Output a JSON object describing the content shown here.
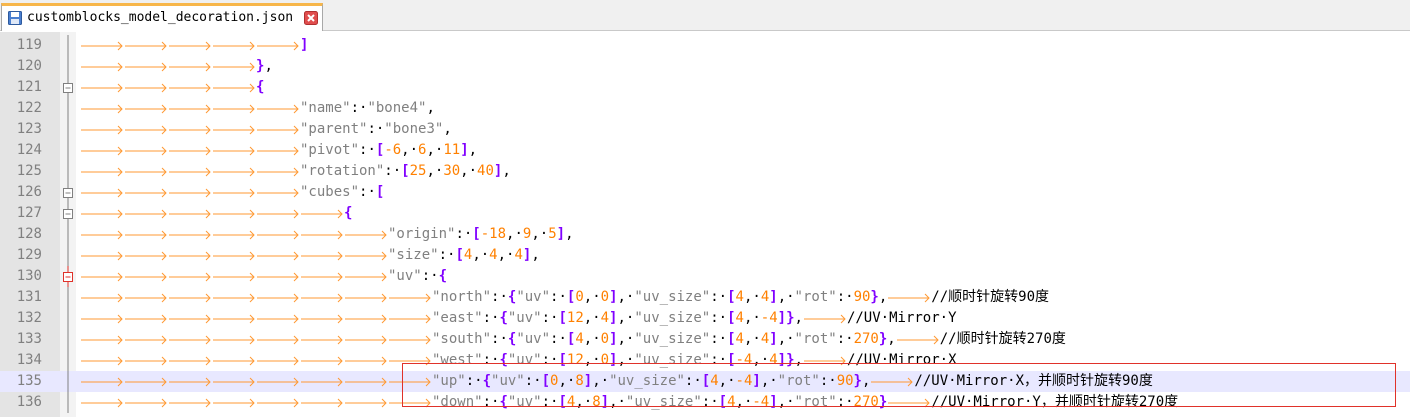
{
  "tab": {
    "label": "customblocks_model_decoration.json",
    "icon": "save-disk-icon",
    "close_icon": "close-icon"
  },
  "colors": {
    "line_number": "#808080",
    "bracket": "#8000ff",
    "string": "#808080",
    "number": "#ff8000",
    "tab_arrow": "#ff9933",
    "fold_marker": "#808080",
    "fold_open_marker": "#e0322a",
    "annotation_box": "#e0322a",
    "current_line": "#e8e8ff"
  },
  "lines": [
    {
      "num": "119",
      "indent": 5,
      "fold": "line",
      "parts": [
        [
          "p",
          "]"
        ]
      ]
    },
    {
      "num": "120",
      "indent": 4,
      "fold": "line",
      "parts": [
        [
          "p",
          "}"
        ],
        [
          "c",
          ","
        ]
      ]
    },
    {
      "num": "121",
      "indent": 4,
      "fold": "box",
      "parts": [
        [
          "p",
          "{"
        ]
      ]
    },
    {
      "num": "122",
      "indent": 5,
      "fold": "line",
      "parts": [
        [
          "s",
          "\"name\""
        ],
        [
          "c",
          ":·"
        ],
        [
          "s",
          "\"bone4\""
        ],
        [
          "c",
          ","
        ]
      ]
    },
    {
      "num": "123",
      "indent": 5,
      "fold": "line",
      "parts": [
        [
          "s",
          "\"parent\""
        ],
        [
          "c",
          ":·"
        ],
        [
          "s",
          "\"bone3\""
        ],
        [
          "c",
          ","
        ]
      ]
    },
    {
      "num": "124",
      "indent": 5,
      "fold": "line",
      "parts": [
        [
          "s",
          "\"pivot\""
        ],
        [
          "c",
          ":·"
        ],
        [
          "p",
          "["
        ],
        [
          "n",
          "-6"
        ],
        [
          "c",
          ",·"
        ],
        [
          "n",
          "6"
        ],
        [
          "c",
          ",·"
        ],
        [
          "n",
          "11"
        ],
        [
          "p",
          "]"
        ],
        [
          "c",
          ","
        ]
      ]
    },
    {
      "num": "125",
      "indent": 5,
      "fold": "line",
      "parts": [
        [
          "s",
          "\"rotation\""
        ],
        [
          "c",
          ":·"
        ],
        [
          "p",
          "["
        ],
        [
          "n",
          "25"
        ],
        [
          "c",
          ",·"
        ],
        [
          "n",
          "30"
        ],
        [
          "c",
          ",·"
        ],
        [
          "n",
          "40"
        ],
        [
          "p",
          "]"
        ],
        [
          "c",
          ","
        ]
      ]
    },
    {
      "num": "126",
      "indent": 5,
      "fold": "box",
      "parts": [
        [
          "s",
          "\"cubes\""
        ],
        [
          "c",
          ":·"
        ],
        [
          "p",
          "["
        ]
      ]
    },
    {
      "num": "127",
      "indent": 6,
      "fold": "box",
      "parts": [
        [
          "p",
          "{"
        ]
      ]
    },
    {
      "num": "128",
      "indent": 7,
      "fold": "line",
      "parts": [
        [
          "s",
          "\"origin\""
        ],
        [
          "c",
          ":·"
        ],
        [
          "p",
          "["
        ],
        [
          "n",
          "-18"
        ],
        [
          "c",
          ",·"
        ],
        [
          "n",
          "9"
        ],
        [
          "c",
          ",·"
        ],
        [
          "n",
          "5"
        ],
        [
          "p",
          "]"
        ],
        [
          "c",
          ","
        ]
      ]
    },
    {
      "num": "129",
      "indent": 7,
      "fold": "line",
      "parts": [
        [
          "s",
          "\"size\""
        ],
        [
          "c",
          ":·"
        ],
        [
          "p",
          "["
        ],
        [
          "n",
          "4"
        ],
        [
          "c",
          ",·"
        ],
        [
          "n",
          "4"
        ],
        [
          "c",
          ",·"
        ],
        [
          "n",
          "4"
        ],
        [
          "p",
          "]"
        ],
        [
          "c",
          ","
        ]
      ]
    },
    {
      "num": "130",
      "indent": 7,
      "fold": "boxred",
      "parts": [
        [
          "s",
          "\"uv\""
        ],
        [
          "c",
          ":·"
        ],
        [
          "p",
          "{"
        ]
      ]
    },
    {
      "num": "131",
      "indent": 8,
      "fold": "line",
      "parts": [
        [
          "s",
          "\"north\""
        ],
        [
          "c",
          ":·"
        ],
        [
          "p",
          "{"
        ],
        [
          "s",
          "\"uv\""
        ],
        [
          "c",
          ":·"
        ],
        [
          "p",
          "["
        ],
        [
          "n",
          "0"
        ],
        [
          "c",
          ",·"
        ],
        [
          "n",
          "0"
        ],
        [
          "p",
          "]"
        ],
        [
          "c",
          ",·"
        ],
        [
          "s",
          "\"uv_size\""
        ],
        [
          "c",
          ":·"
        ],
        [
          "p",
          "["
        ],
        [
          "n",
          "4"
        ],
        [
          "c",
          ",·"
        ],
        [
          "n",
          "4"
        ],
        [
          "p",
          "]"
        ],
        [
          "c",
          ",·"
        ],
        [
          "s",
          "\"rot\""
        ],
        [
          "c",
          ":·"
        ],
        [
          "n",
          "90"
        ],
        [
          "p",
          "}"
        ],
        [
          "c",
          ","
        ],
        [
          "t",
          "→"
        ],
        [
          "c",
          "//顺时针旋转90度"
        ]
      ]
    },
    {
      "num": "132",
      "indent": 8,
      "fold": "line",
      "parts": [
        [
          "s",
          "\"east\""
        ],
        [
          "c",
          ":·"
        ],
        [
          "p",
          "{"
        ],
        [
          "s",
          "\"uv\""
        ],
        [
          "c",
          ":·"
        ],
        [
          "p",
          "["
        ],
        [
          "n",
          "12"
        ],
        [
          "c",
          ",·"
        ],
        [
          "n",
          "4"
        ],
        [
          "p",
          "]"
        ],
        [
          "c",
          ",·"
        ],
        [
          "s",
          "\"uv_size\""
        ],
        [
          "c",
          ":·"
        ],
        [
          "p",
          "["
        ],
        [
          "n",
          "4"
        ],
        [
          "c",
          ",·"
        ],
        [
          "n",
          "-4"
        ],
        [
          "p",
          "]}"
        ],
        [
          "c",
          ","
        ],
        [
          "t",
          "→"
        ],
        [
          "c",
          "//UV·Mirror·Y"
        ]
      ]
    },
    {
      "num": "133",
      "indent": 8,
      "fold": "line",
      "parts": [
        [
          "s",
          "\"south\""
        ],
        [
          "c",
          ":·"
        ],
        [
          "p",
          "{"
        ],
        [
          "s",
          "\"uv\""
        ],
        [
          "c",
          ":·"
        ],
        [
          "p",
          "["
        ],
        [
          "n",
          "4"
        ],
        [
          "c",
          ",·"
        ],
        [
          "n",
          "0"
        ],
        [
          "p",
          "]"
        ],
        [
          "c",
          ",·"
        ],
        [
          "s",
          "\"uv_size\""
        ],
        [
          "c",
          ":·"
        ],
        [
          "p",
          "["
        ],
        [
          "n",
          "4"
        ],
        [
          "c",
          ",·"
        ],
        [
          "n",
          "4"
        ],
        [
          "p",
          "]"
        ],
        [
          "c",
          ",·"
        ],
        [
          "s",
          "\"rot\""
        ],
        [
          "c",
          ":·"
        ],
        [
          "n",
          "270"
        ],
        [
          "p",
          "}"
        ],
        [
          "c",
          ","
        ],
        [
          "t",
          "→"
        ],
        [
          "c",
          "//顺时针旋转270度"
        ]
      ]
    },
    {
      "num": "134",
      "indent": 8,
      "fold": "line",
      "parts": [
        [
          "s",
          "\"west\""
        ],
        [
          "c",
          ":·"
        ],
        [
          "p",
          "{"
        ],
        [
          "s",
          "\"uv\""
        ],
        [
          "c",
          ":·"
        ],
        [
          "p",
          "["
        ],
        [
          "n",
          "12"
        ],
        [
          "c",
          ",·"
        ],
        [
          "n",
          "0"
        ],
        [
          "p",
          "]"
        ],
        [
          "c",
          ",·"
        ],
        [
          "s",
          "\"uv_size\""
        ],
        [
          "c",
          ":·"
        ],
        [
          "p",
          "["
        ],
        [
          "n",
          "-4"
        ],
        [
          "c",
          ",·"
        ],
        [
          "n",
          "4"
        ],
        [
          "p",
          "]}"
        ],
        [
          "c",
          ","
        ],
        [
          "t",
          "→"
        ],
        [
          "c",
          "//UV·Mirror·X"
        ]
      ]
    },
    {
      "num": "135",
      "indent": 8,
      "fold": "line",
      "current": true,
      "parts": [
        [
          "s",
          "\"up\""
        ],
        [
          "c",
          ":·"
        ],
        [
          "p",
          "{"
        ],
        [
          "s",
          "\"uv\""
        ],
        [
          "c",
          ":·"
        ],
        [
          "p",
          "["
        ],
        [
          "n",
          "0"
        ],
        [
          "c",
          ",·"
        ],
        [
          "n",
          "8"
        ],
        [
          "p",
          "]"
        ],
        [
          "c",
          ",·"
        ],
        [
          "s",
          "\"uv_size\""
        ],
        [
          "c",
          ":·"
        ],
        [
          "p",
          "["
        ],
        [
          "n",
          "4"
        ],
        [
          "c",
          ",·"
        ],
        [
          "n",
          "-4"
        ],
        [
          "p",
          "]"
        ],
        [
          "c",
          ",·"
        ],
        [
          "s",
          "\"rot\""
        ],
        [
          "c",
          ":·"
        ],
        [
          "n",
          "90"
        ],
        [
          "p",
          "}"
        ],
        [
          "c",
          ","
        ],
        [
          "t",
          "→"
        ],
        [
          "c",
          "//UV·Mirror·X，并顺时针旋转90度"
        ]
      ]
    },
    {
      "num": "136",
      "indent": 8,
      "fold": "line",
      "parts": [
        [
          "s",
          "\"down\""
        ],
        [
          "c",
          ":·"
        ],
        [
          "p",
          "{"
        ],
        [
          "s",
          "\"uv\""
        ],
        [
          "c",
          ":·"
        ],
        [
          "p",
          "["
        ],
        [
          "n",
          "4"
        ],
        [
          "c",
          ",·"
        ],
        [
          "n",
          "8"
        ],
        [
          "p",
          "]"
        ],
        [
          "c",
          ",·"
        ],
        [
          "s",
          "\"uv_size\""
        ],
        [
          "c",
          ":·"
        ],
        [
          "p",
          "["
        ],
        [
          "n",
          "4"
        ],
        [
          "c",
          ",·"
        ],
        [
          "n",
          "-4"
        ],
        [
          "p",
          "]"
        ],
        [
          "c",
          ",·"
        ],
        [
          "s",
          "\"rot\""
        ],
        [
          "c",
          ":·"
        ],
        [
          "n",
          "270"
        ],
        [
          "p",
          "}"
        ],
        [
          "t",
          "→"
        ],
        [
          "c",
          "//UV·Mirror·Y，并顺时针旋转270度"
        ]
      ]
    }
  ]
}
